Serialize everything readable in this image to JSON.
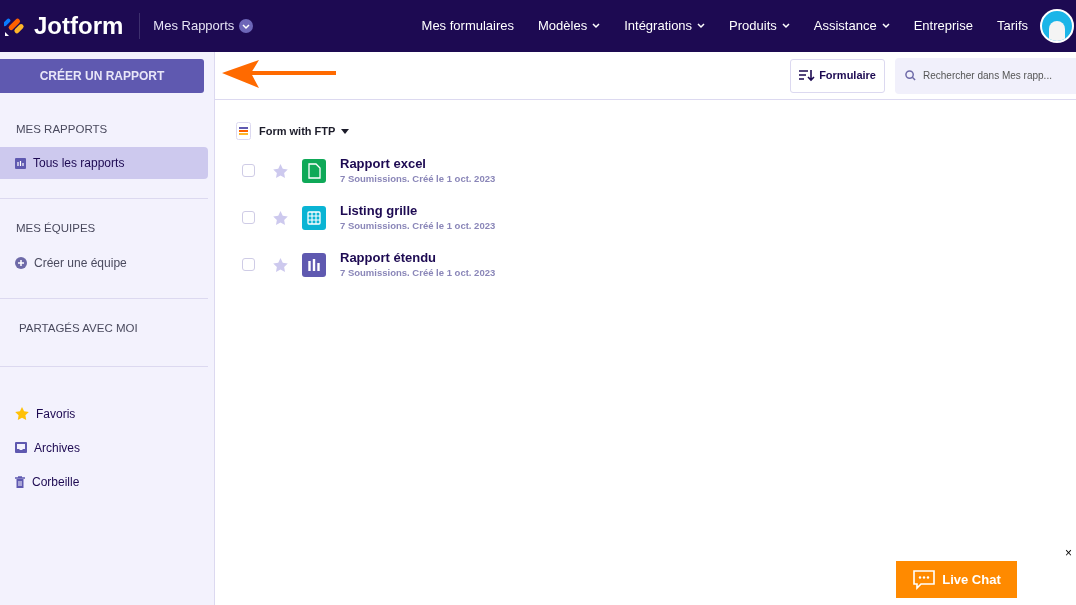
{
  "header": {
    "brand": "Jotform",
    "section": "Mes Rapports",
    "nav": [
      {
        "label": "Mes formulaires",
        "dropdown": false
      },
      {
        "label": "Modèles",
        "dropdown": true
      },
      {
        "label": "Intégrations",
        "dropdown": true
      },
      {
        "label": "Produits",
        "dropdown": true
      },
      {
        "label": "Assistance",
        "dropdown": true
      },
      {
        "label": "Entreprise",
        "dropdown": false
      },
      {
        "label": "Tarifs",
        "dropdown": false
      }
    ]
  },
  "toolbar": {
    "create_button": "CRÉER UN RAPPORT",
    "sort_button": "Formulaire",
    "search": {
      "placeholder": "Rechercher dans Mes rapp..."
    }
  },
  "sidebar": {
    "sections": [
      {
        "title": "MES RAPPORTS",
        "items": [
          {
            "label": "Tous les rapports",
            "kind": "reports",
            "selected": true
          }
        ]
      },
      {
        "title": "MES ÉQUIPES",
        "items": [
          {
            "label": "Créer une équipe",
            "kind": "add",
            "selected": false
          }
        ]
      },
      {
        "title": "PARTAGÉS AVEC MOI"
      }
    ],
    "bottom_items": [
      {
        "label": "Favoris",
        "kind": "star",
        "selected": false
      },
      {
        "label": "Archives",
        "kind": "archive",
        "selected": false
      },
      {
        "label": "Corbeille",
        "kind": "trash",
        "selected": false
      }
    ]
  },
  "form_group": {
    "title": "Form with FTP",
    "reports": [
      {
        "name": "Rapport excel",
        "meta": "7 Soumissions. Créé le 1 oct. 2023",
        "kind": "excel",
        "checked": false,
        "starred": false
      },
      {
        "name": "Listing grille",
        "meta": "7 Soumissions. Créé le 1 oct. 2023",
        "kind": "grid",
        "checked": false,
        "starred": false
      },
      {
        "name": "Rapport étendu",
        "meta": "7 Soumissions. Créé le 1 oct. 2023",
        "kind": "extended",
        "checked": false,
        "starred": false
      }
    ]
  },
  "live_chat": {
    "label": "Live Chat",
    "close": "×"
  }
}
